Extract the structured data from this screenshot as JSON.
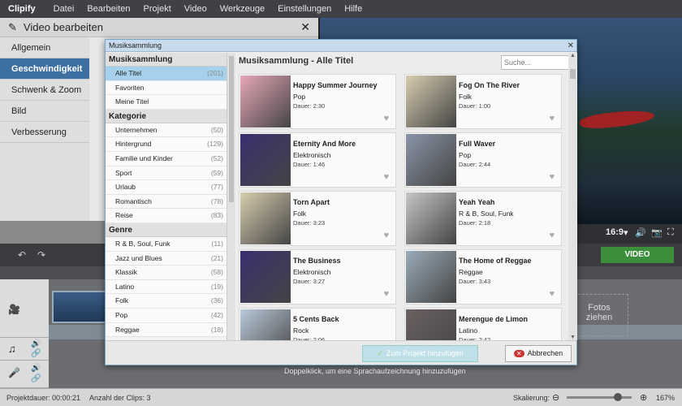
{
  "menubar": {
    "app": "Clipify",
    "items": [
      "Datei",
      "Bearbeiten",
      "Projekt",
      "Video",
      "Werkzeuge",
      "Einstellungen",
      "Hilfe"
    ]
  },
  "editor": {
    "title": "Video bearbeiten",
    "close": "✕",
    "nav": [
      {
        "label": "Allgemein"
      },
      {
        "label": "Geschwindigkeit"
      },
      {
        "label": "Schwenk & Zoom"
      },
      {
        "label": "Bild"
      },
      {
        "label": "Verbesserung"
      }
    ]
  },
  "preview": {
    "ratio": "16:9",
    "ratio_arrow": "▾",
    "volume_icon": "🔊",
    "camera_icon": "📷",
    "fullscreen_icon": "⛶"
  },
  "timeline": {
    "undo_icon": "↶",
    "redo_icon": "↷",
    "export_label": "VIDEO ERSTELLEN",
    "drop_label": "Fotos\nziehen",
    "voice_hint": "Doppelklick, um eine Sprachaufzeichnung hinzuzufügen",
    "video_icon": "🎥",
    "music_icon": "♫",
    "mic_icon": "🎤",
    "speaker_icon": "🔊",
    "link_icon": "🔗"
  },
  "status": {
    "duration": "Projektdauer:  00:00:21",
    "clips": "Anzahl der Clips: 3",
    "scale_label": "Skalierung:",
    "minus": "⊖",
    "plus": "⊕",
    "zoom": "167%"
  },
  "dialog": {
    "title": "Musiksammlung",
    "close": "✕",
    "heading": "Musiksammlung - Alle Titel",
    "search_placeholder": "Suche...",
    "sections": [
      {
        "title": "Musiksammlung",
        "rows": [
          {
            "label": "Alle Titel",
            "count": "(201)",
            "selected": true
          },
          {
            "label": "Favoriten",
            "count": ""
          },
          {
            "label": "Meine Titel",
            "count": ""
          }
        ]
      },
      {
        "title": "Kategorie",
        "rows": [
          {
            "label": "Unternehmen",
            "count": "(50)"
          },
          {
            "label": "Hintergrund",
            "count": "(129)"
          },
          {
            "label": "Familie und Kinder",
            "count": "(52)"
          },
          {
            "label": "Sport",
            "count": "(59)"
          },
          {
            "label": "Urlaub",
            "count": "(77)"
          },
          {
            "label": "Romantisch",
            "count": "(78)"
          },
          {
            "label": "Reise",
            "count": "(83)"
          }
        ]
      },
      {
        "title": "Genre",
        "rows": [
          {
            "label": "R & B, Soul, Funk",
            "count": "(11)"
          },
          {
            "label": "Jazz und Blues",
            "count": "(21)"
          },
          {
            "label": "Klassik",
            "count": "(58)"
          },
          {
            "label": "Latino",
            "count": "(19)"
          },
          {
            "label": "Folk",
            "count": "(36)"
          },
          {
            "label": "Pop",
            "count": "(42)"
          },
          {
            "label": "Reggae",
            "count": "(18)"
          }
        ]
      }
    ],
    "tracks": [
      {
        "title": "Happy Summer Journey",
        "genre": "Pop",
        "duration": "Dauer: 2:30",
        "thumb": "#e6a7b8"
      },
      {
        "title": "Fog On The River",
        "genre": "Folk",
        "duration": "Dauer: 1:00",
        "thumb": "#d8cdb0"
      },
      {
        "title": "Eternity And More",
        "genre": "Elektronisch",
        "duration": "Dauer: 1:46",
        "thumb": "#3a2f6e"
      },
      {
        "title": "Full Waver",
        "genre": "Pop",
        "duration": "Dauer: 2:44",
        "thumb": "#8a95a8"
      },
      {
        "title": "Torn Apart",
        "genre": "Folk",
        "duration": "Dauer: 3:23",
        "thumb": "#d8cdb0"
      },
      {
        "title": "Yeah Yeah",
        "genre": "R & B, Soul, Funk",
        "duration": "Dauer: 2:18",
        "thumb": "#c6c6c6"
      },
      {
        "title": "The Business",
        "genre": "Elektronisch",
        "duration": "Dauer: 3:27",
        "thumb": "#3a2f6e"
      },
      {
        "title": "The Home of Reggae",
        "genre": "Reggae",
        "duration": "Dauer: 3:43",
        "thumb": "#9aabb8"
      },
      {
        "title": "5 Cents Back",
        "genre": "Rock",
        "duration": "Dauer: 2:06",
        "thumb": "#b9c9da"
      },
      {
        "title": "Merengue de Limon",
        "genre": "Latino",
        "duration": "Dauer: 2:42",
        "thumb": "#6a6060"
      }
    ],
    "add_label": "Zum Projekt hinzufügen",
    "add_check": "✓",
    "cancel_label": "Abbrechen",
    "cancel_x": "✕",
    "heart": "♥",
    "scroll_up": "▲",
    "scroll_down": "▼"
  }
}
